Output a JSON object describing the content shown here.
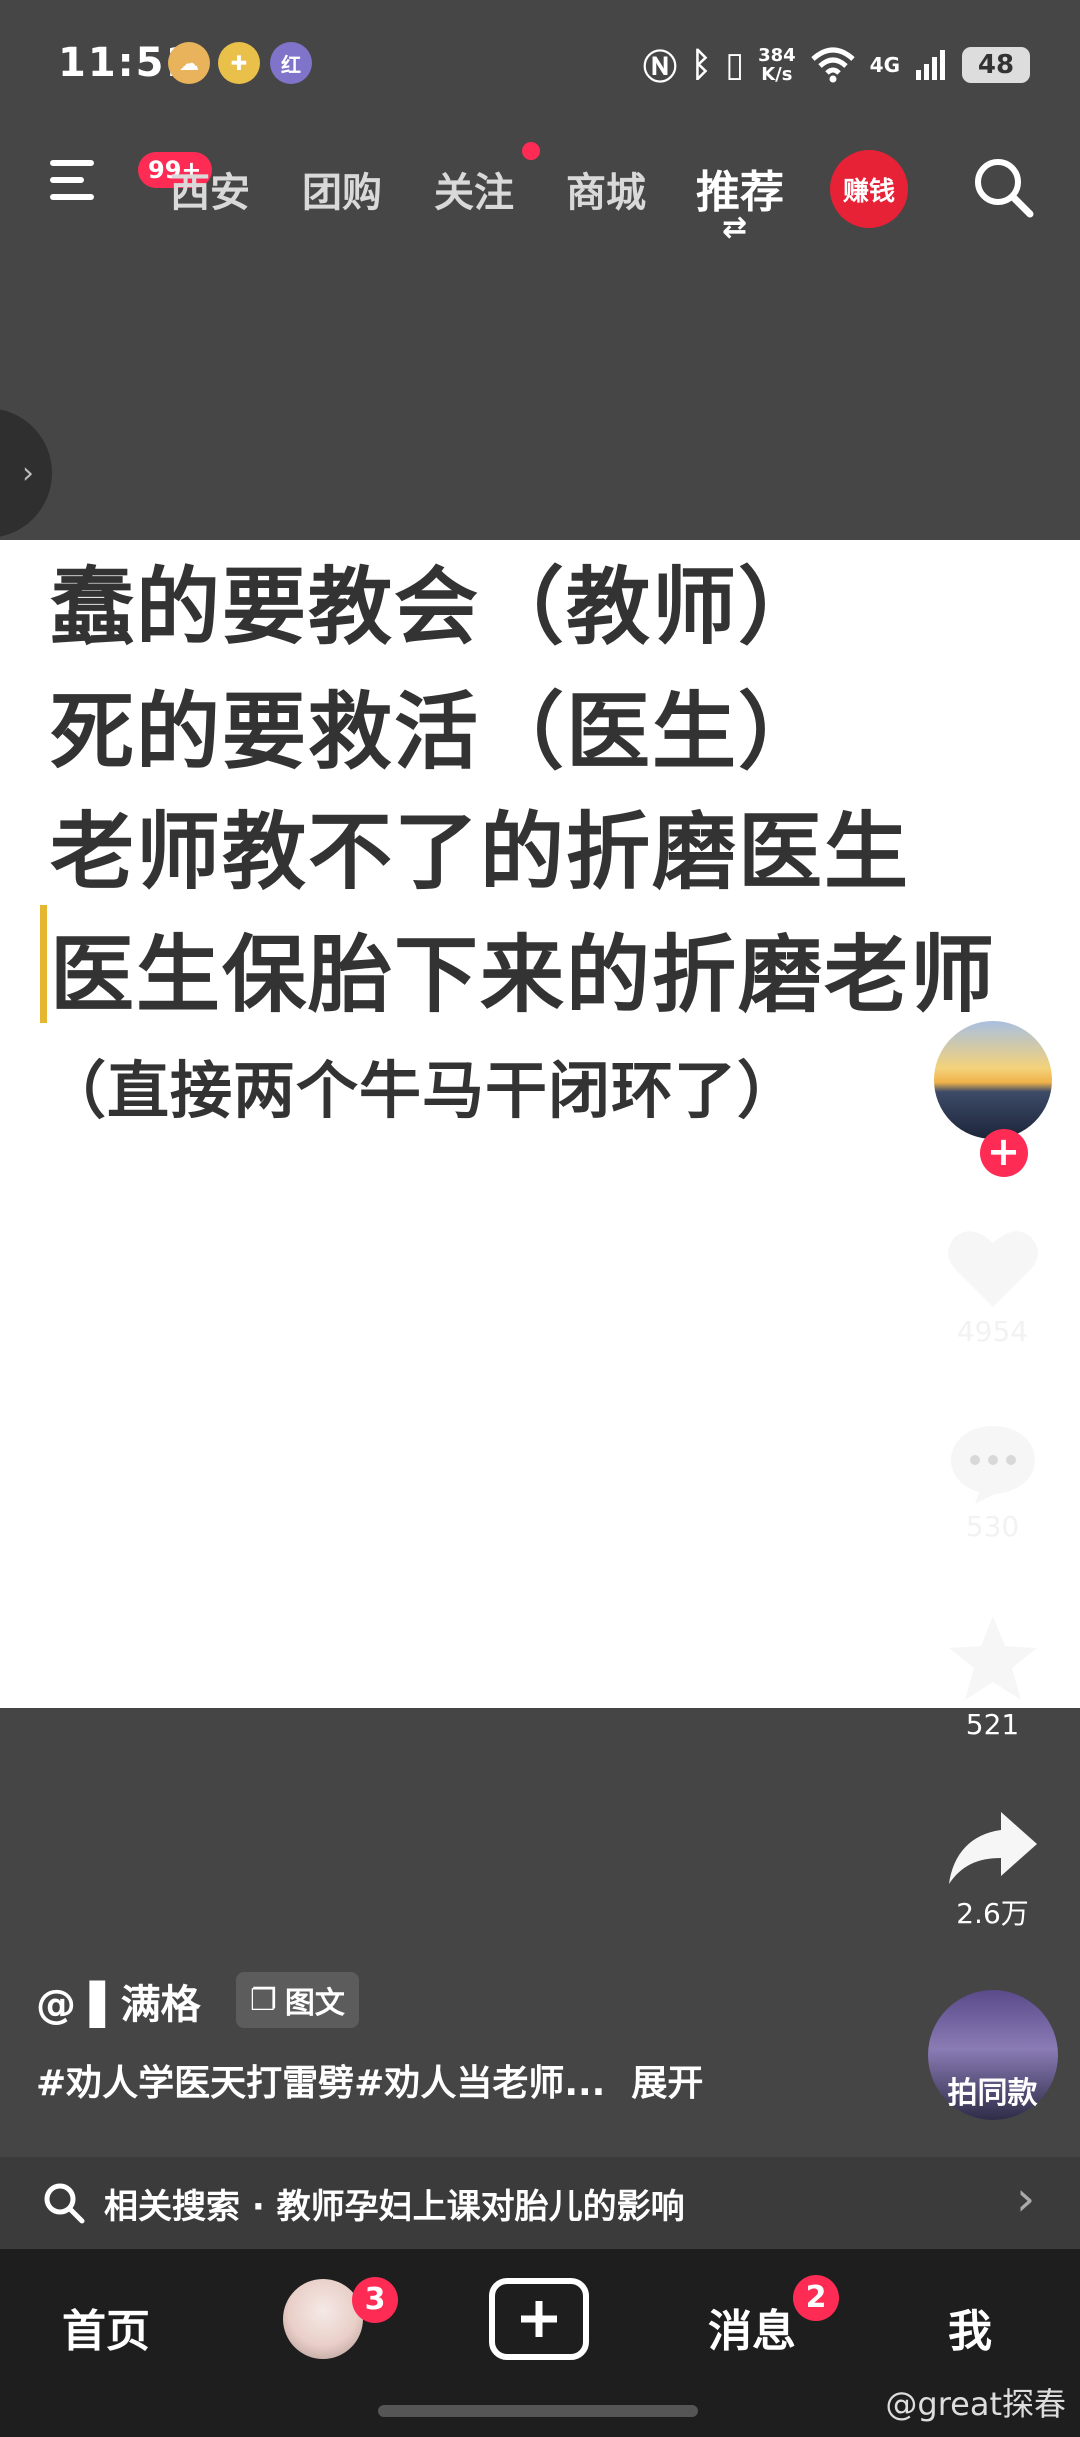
{
  "status_bar": {
    "time": "11:51",
    "apps": [
      "weather-app-icon",
      "health-app-icon",
      "red-app-icon"
    ],
    "red_app_label": "红",
    "speed_value": "384",
    "speed_unit": "K/s",
    "network": "4G",
    "battery": "48"
  },
  "nav": {
    "menu_badge": "99+",
    "tabs": [
      {
        "label": "西安"
      },
      {
        "label": "团购"
      },
      {
        "label": "关注"
      },
      {
        "label": "商城"
      },
      {
        "label": "推荐"
      }
    ],
    "active_tab": "推荐",
    "earn_label": "赚钱"
  },
  "content": {
    "lines": [
      "蠢的要教会（教师）",
      "死的要救活（医生）",
      "老师教不了的折磨医生",
      "医生保胎下来的折磨老师",
      "（直接两个牛马干闭环了）"
    ]
  },
  "side": {
    "like_count": "4954",
    "comment_count": "530",
    "favorite_count": "521",
    "share_count": "2.6万",
    "same_style_label": "拍同款"
  },
  "post": {
    "author": "@ ▌满格",
    "type_label": "图文",
    "caption": "#劝人学医天打雷劈#劝人当老师...",
    "expand_label": "展开"
  },
  "related": {
    "text": "相关搜索 · 教师孕妇上课对胎儿的影响"
  },
  "bottom_nav": {
    "home": "首页",
    "friends_badge": "3",
    "messages": "消息",
    "messages_badge": "2",
    "me": "我"
  },
  "watermark": "@great探春",
  "colors": {
    "accent": "#fe2c55",
    "cursor": "#e5b62f",
    "text_dark": "#333333"
  }
}
